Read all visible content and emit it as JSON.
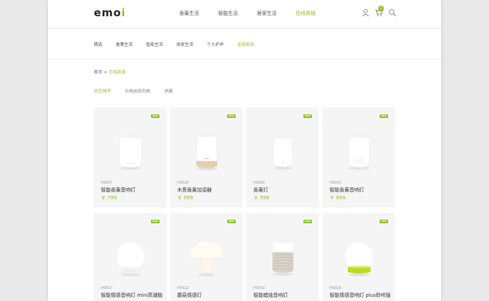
{
  "brand": {
    "logo_main": "emo",
    "logo_end": "i",
    "accent_color": "#8ec31f"
  },
  "mainnav": [
    {
      "label": "香薰生活",
      "active": false
    },
    {
      "label": "智能生活",
      "active": false
    },
    {
      "label": "居家生活",
      "active": false
    },
    {
      "label": "在线商城",
      "active": true
    }
  ],
  "header_icons": {
    "user": "user-icon",
    "cart": "cart-icon",
    "search": "search-icon",
    "cart_count": "2"
  },
  "subnav": [
    {
      "label": "精选",
      "active": false
    },
    {
      "label": "香薰生活",
      "active": false
    },
    {
      "label": "智能生活",
      "active": false
    },
    {
      "label": "居家生活",
      "active": false
    },
    {
      "label": "个人护声",
      "active": false
    },
    {
      "label": "全部商品",
      "active": true
    }
  ],
  "breadcrumb": {
    "home": "首页",
    "sep": " > ",
    "current": "在线商城"
  },
  "sort": [
    {
      "label": "综合排序",
      "active": true
    },
    {
      "label": "价格由低到高",
      "active": false
    },
    {
      "label": "销量",
      "active": false
    }
  ],
  "products": [
    {
      "badge": "NEW",
      "sku": "H0027",
      "name": "智能香薰音响灯",
      "price": "￥ 799",
      "image": "white-diffuser"
    },
    {
      "badge": "NEW",
      "sku": "H0028",
      "name": "木质香薰加湿器",
      "price": "￥ 599",
      "image": "wood-diffuser"
    },
    {
      "badge": "NEW",
      "sku": "H0030",
      "name": "香薰灯",
      "price": "￥ 599",
      "image": "white-diffuser-small"
    },
    {
      "badge": "NEW",
      "sku": "H0035",
      "name": "智能香薰音响灯",
      "price": "￥ 699",
      "image": "white-speaker-diffuser"
    },
    {
      "badge": "NEW",
      "sku": "H0017",
      "name": "智能情感音响灯 mini高潮版",
      "price": "",
      "image": "globe-lamp"
    },
    {
      "badge": "NEW",
      "sku": "H0022",
      "name": "蘑菇情感灯",
      "price": "",
      "image": "mushroom-lamp"
    },
    {
      "badge": "NEW",
      "sku": "H0042",
      "name": "智能蜡烛音响灯",
      "price": "",
      "image": "candle-speaker"
    },
    {
      "badge": "NEW",
      "sku": "H0018",
      "name": "智能情感音响灯 plus聆听版",
      "price": "",
      "image": "globe-lamp-green"
    }
  ]
}
